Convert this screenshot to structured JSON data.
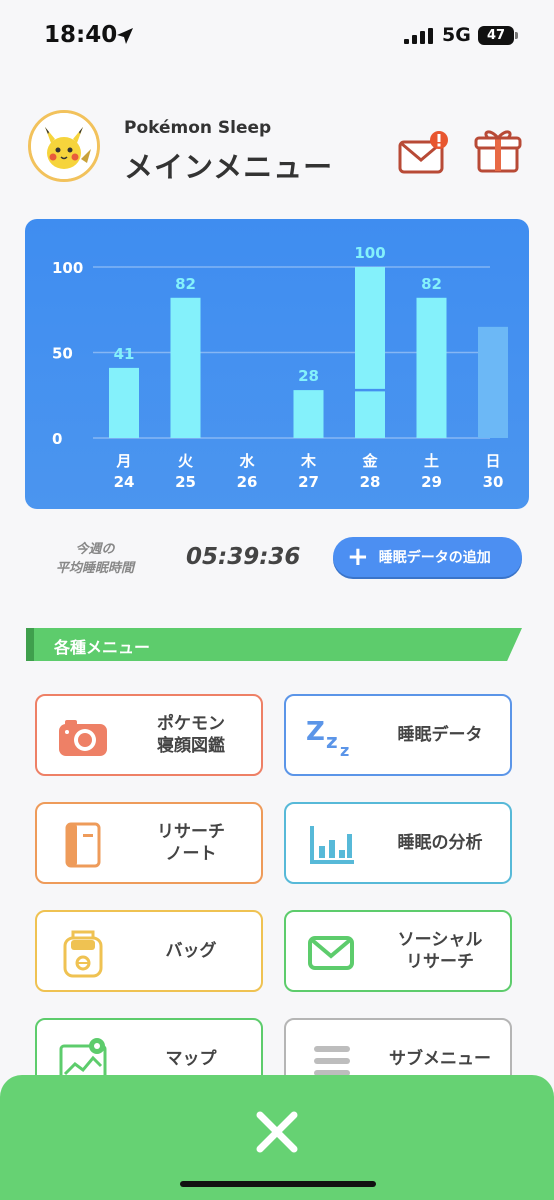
{
  "status_bar": {
    "time": "18:40",
    "network": "5G",
    "battery": "47"
  },
  "header": {
    "app_name": "Pokémon Sleep",
    "title": "メインメニュー"
  },
  "colors": {
    "chart_bg": "#4490f0",
    "bar": "#84f1fb",
    "bar_faded": "#6cb8f6",
    "accent_green": "#5dcc6c",
    "button_blue": "#4c8ff2"
  },
  "chart_data": {
    "type": "bar",
    "categories": [
      "月",
      "火",
      "水",
      "木",
      "金",
      "土",
      "日"
    ],
    "dates": [
      "24",
      "25",
      "26",
      "27",
      "28",
      "29",
      "30"
    ],
    "values": [
      41,
      82,
      null,
      28,
      100,
      82,
      65
    ],
    "value_labels": [
      "41",
      "82",
      "",
      "28",
      "100",
      "82",
      ""
    ],
    "yticks": [
      0,
      50,
      100
    ],
    "ylim": [
      0,
      100
    ],
    "segments_on_28": [
      28,
      72
    ],
    "faded_index": 6
  },
  "weekly": {
    "label": "今週の\n平均睡眠時間",
    "time": "05:39:36"
  },
  "add_button": {
    "label": "睡眠データの追加"
  },
  "section": {
    "label": "各種メニュー"
  },
  "menu": [
    {
      "label": "ポケモン\n寝顔図鑑",
      "icon": "camera-icon",
      "color": "#ee8066"
    },
    {
      "label": "睡眠データ",
      "icon": "zzz-icon",
      "color": "#5b95e8"
    },
    {
      "label": "リサーチ\nノート",
      "icon": "notebook-icon",
      "color": "#ee9b5a"
    },
    {
      "label": "睡眠の分析",
      "icon": "bar-chart-icon",
      "color": "#57b9d8"
    },
    {
      "label": "バッグ",
      "icon": "bag-icon",
      "color": "#efc252"
    },
    {
      "label": "ソーシャル\nリサーチ",
      "icon": "envelope-icon",
      "color": "#5dcc6c"
    },
    {
      "label": "マップ",
      "icon": "map-icon",
      "color": "#5dcc6c"
    },
    {
      "label": "サブメニュー",
      "icon": "list-icon",
      "color": "#b5b5b5"
    }
  ]
}
